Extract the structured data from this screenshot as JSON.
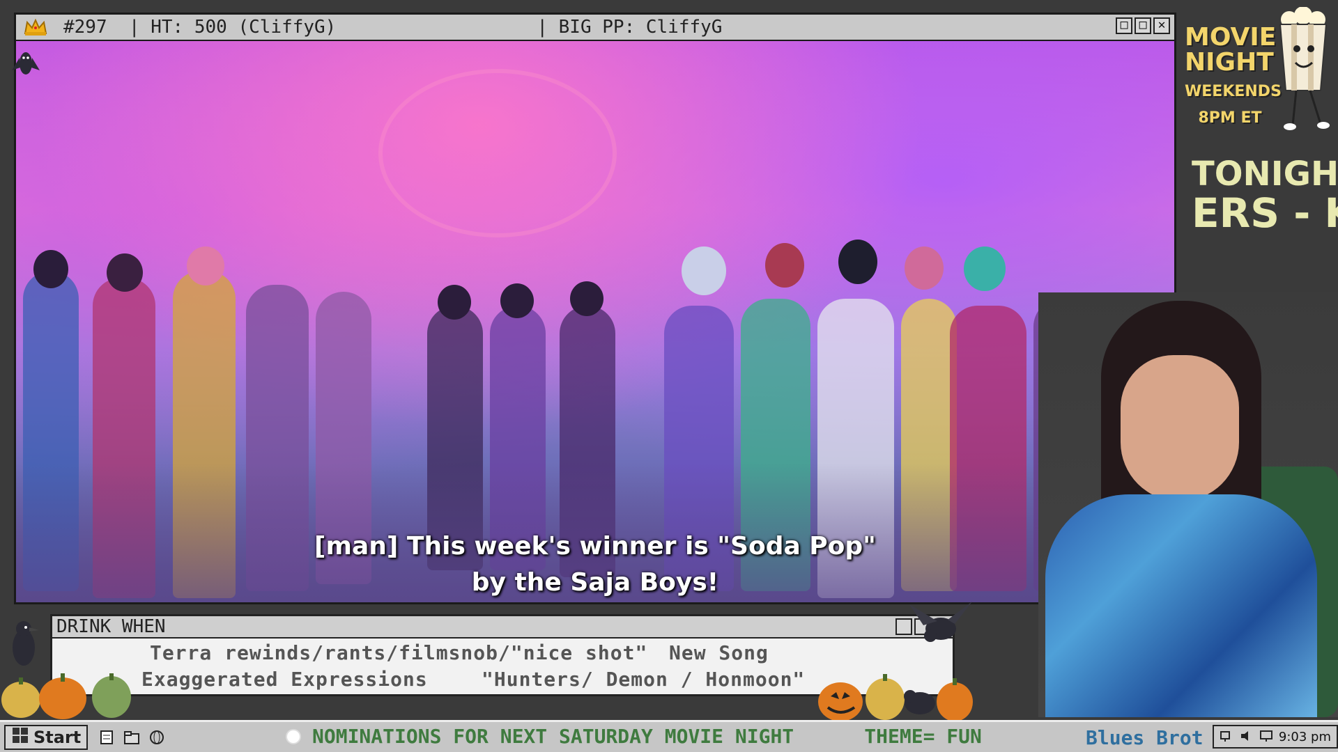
{
  "window": {
    "title_left": "#297  | HT: 500 (CliffyG)",
    "title_right": "| BIG PP: CliffyG",
    "controls": [
      "□",
      "□",
      "✕"
    ]
  },
  "video": {
    "subtitle_line1": "[man] This week's winner is \"Soda Pop\"",
    "subtitle_line2": "by the Saja Boys!"
  },
  "drink_box": {
    "title": "DRINK WHEN",
    "item1": "Terra rewinds/rants/filmsnob/\"nice shot\"",
    "item2": "New Song",
    "item3": "Exaggerated Expressions",
    "item4": "\"Hunters/ Demon / Honmoon\""
  },
  "movie_night": {
    "title_line1": "MOVIE",
    "title_line2": "NIGHT",
    "schedule_line1": "WEEKENDS",
    "schedule_line2": "8PM ET"
  },
  "tonight": {
    "label": "TONIGHT:",
    "marquee": "ERS - K"
  },
  "taskbar": {
    "start_label": "Start",
    "ticker_text": "NOMINATIONS FOR NEXT SATURDAY MOVIE NIGHT      THEME= FUN",
    "now_playing": "Blues Brot",
    "clock": "9:03 pm"
  },
  "icons": {
    "crown": "crown-icon",
    "bat": "bat-icon",
    "popcorn": "popcorn-mascot-icon",
    "crow": "crow-icon",
    "pumpkin": "pumpkin-icon",
    "windows": "windows-logo-icon"
  },
  "colors": {
    "ticker": "#3f7b3f",
    "now_playing": "#2f6f9f",
    "movie_night_title": "#f3d56b",
    "tonight_text": "#e8e9b0"
  }
}
